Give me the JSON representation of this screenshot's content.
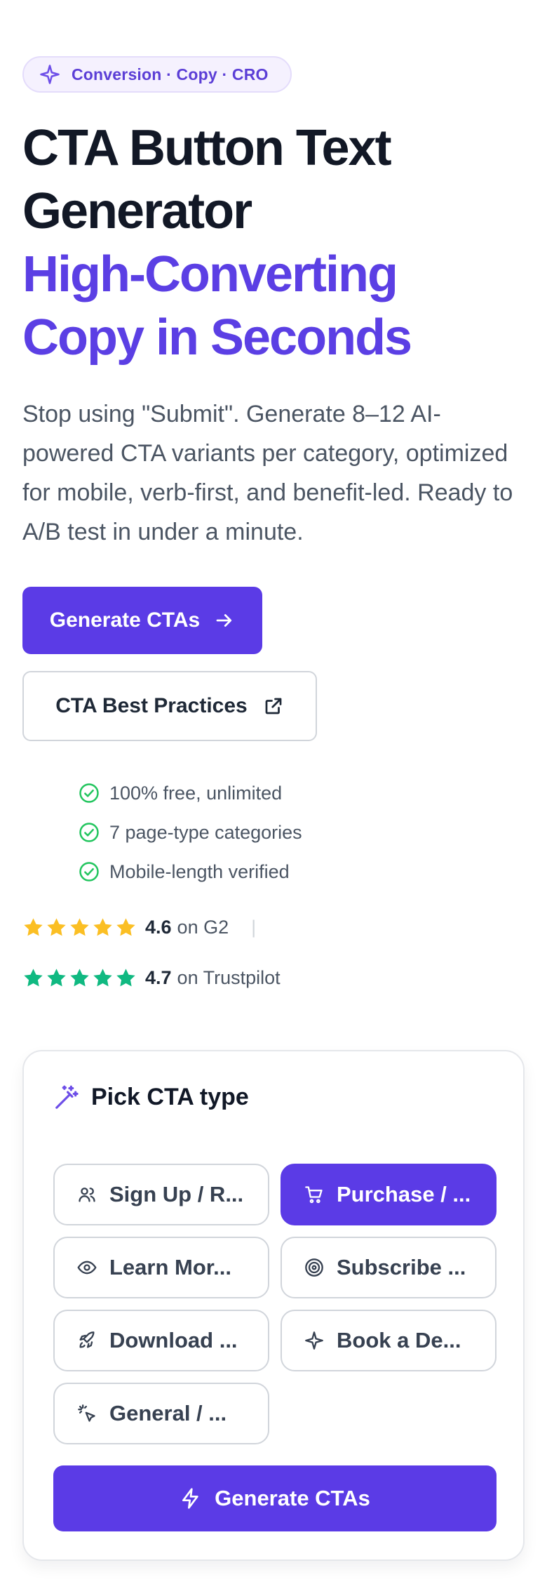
{
  "badge": {
    "icon": "sparkle-icon",
    "label": "Conversion · Copy · CRO"
  },
  "hero": {
    "title_line1": "CTA Button Text",
    "title_line2": "Generator",
    "title_line3": "High-Converting",
    "title_line4": "Copy in Seconds",
    "description": "Stop using \"Submit\". Generate 8–12 AI-powered CTA variants per category, optimized for mobile, verb-first, and benefit-led. Ready to A/B test in under a minute."
  },
  "buttons": {
    "primary": {
      "label": "Generate CTAs",
      "icon": "arrow-right-icon"
    },
    "secondary": {
      "label": "CTA Best Practices",
      "icon": "external-link-icon"
    }
  },
  "features": [
    "100% free, unlimited",
    "7 page-type categories",
    "Mobile-length verified"
  ],
  "ratings": [
    {
      "score": "4.6",
      "source": "on G2",
      "stars": 5,
      "color": "#fbbf24",
      "separator": "|"
    },
    {
      "score": "4.7",
      "source": "on Trustpilot",
      "stars": 5,
      "color": "#10b981"
    }
  ],
  "picker": {
    "heading": "Pick CTA type",
    "heading_icon": "magic-wand-icon",
    "options": [
      {
        "label": "Sign Up / R...",
        "icon": "users-icon",
        "selected": false
      },
      {
        "label": "Purchase / ...",
        "icon": "cart-icon",
        "selected": true
      },
      {
        "label": "Learn Mor...",
        "icon": "eye-icon",
        "selected": false
      },
      {
        "label": "Subscribe ...",
        "icon": "target-icon",
        "selected": false
      },
      {
        "label": "Download ...",
        "icon": "rocket-icon",
        "selected": false
      },
      {
        "label": "Book a De...",
        "icon": "sparkle-icon",
        "selected": false
      },
      {
        "label": "General / ...",
        "icon": "pointer-click-icon",
        "selected": false
      }
    ],
    "generate_label": "Generate CTAs",
    "generate_icon": "lightning-icon"
  },
  "colors": {
    "accent": "#5b3be6",
    "check": "#22c55e",
    "g2_star": "#fbbf24",
    "trustpilot_star": "#10b981"
  }
}
